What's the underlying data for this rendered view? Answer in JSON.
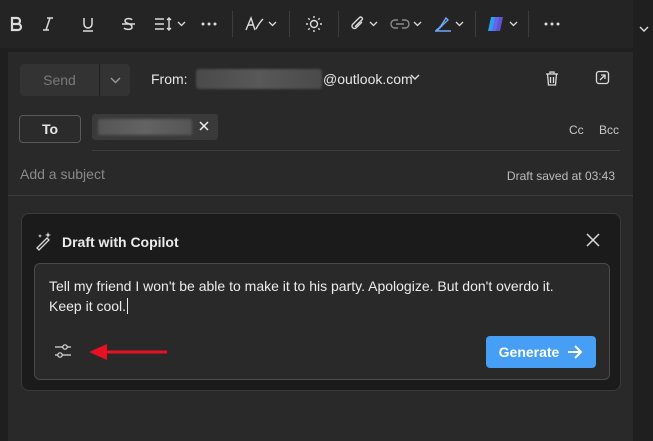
{
  "toolbar": {
    "items": [
      "bold-icon",
      "italic-icon",
      "underline-icon",
      "strikethrough-icon",
      "line-spacing-icon",
      "more-icon",
      "text-style-icon",
      "sun-icon",
      "attach-icon",
      "link-icon",
      "signature-icon",
      "copilot-icon",
      "more-icon"
    ]
  },
  "compose": {
    "send_label": "Send",
    "from_label": "From:",
    "from_domain": "@outlook.com",
    "to_label": "To",
    "cc_label": "Cc",
    "bcc_label": "Bcc",
    "subject_placeholder": "Add a subject",
    "draft_status": "Draft saved at 03:43"
  },
  "copilot": {
    "title": "Draft with Copilot",
    "prompt": "Tell my friend I won't be able to make it to his party. Apologize. But don't overdo it. Keep it cool.",
    "generate_label": "Generate"
  },
  "colors": {
    "accent": "#479ef5",
    "annotation_arrow": "#e81123",
    "background": "#1f1f1f"
  }
}
